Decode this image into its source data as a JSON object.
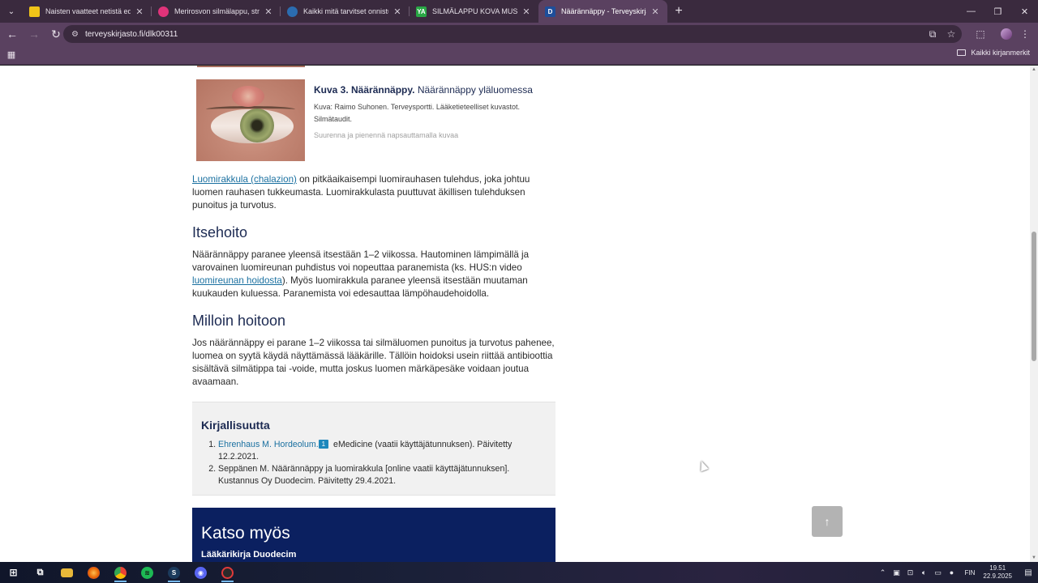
{
  "browser": {
    "tabs": [
      {
        "title": "Naisten vaatteet netistä edullise",
        "favicon_color": "#f0c419",
        "favicon_text": ""
      },
      {
        "title": "Merirosvon silmälappu, strassi j",
        "favicon_color": "#e0337a",
        "favicon_text": ""
      },
      {
        "title": "Kaikki mitä tarvitset onnistunee",
        "favicon_color": "#2b6cb0",
        "favicon_text": ""
      },
      {
        "title": "SILMÄLAPPU KOVA MUSTA KU",
        "favicon_color": "#29a745",
        "favicon_text": "YA"
      },
      {
        "title": "Näärännäppy - Terveyskirjasto",
        "favicon_color": "#1e4e9a",
        "favicon_text": "D"
      }
    ],
    "active_tab_index": 4,
    "url": "terveyskirjasto.fi/dlk00311",
    "bookmarks_all_label": "Kaikki kirjanmerkit"
  },
  "page": {
    "figure": {
      "title_bold": "Kuva 3. Näärännäppy.",
      "title_rest": " Näärännäppy yläluomessa",
      "credit": "Kuva: Raimo Suhonen. Terveysportti. Lääketieteelliset kuvastot. Silmätaudit.",
      "hint": "Suurenna ja pienennä napsauttamalla kuvaa"
    },
    "chalazion": {
      "link": "Luomirakkula (chalazion)",
      "text": " on pitkäaikaisempi luomirauhasen tulehdus, joka johtuu luomen rauhasen tukkeumasta. Luomirakkulasta puuttuvat äkillisen tulehduksen punoitus ja turvotus."
    },
    "itsehoito": {
      "heading": "Itsehoito",
      "text_before": "Näärännäppy paranee yleensä itsestään 1–2 viikossa. Hautominen lämpimällä ja varovainen luomireunan puhdistus voi nopeuttaa paranemista (ks. HUS:n video ",
      "link": "luomireunan hoidosta",
      "text_after": "). Myös luomirakkula paranee yleensä itsestään muutaman kuukauden kuluessa. Paranemista voi edesauttaa lämpöhaudehoidolla."
    },
    "milloin": {
      "heading": "Milloin hoitoon",
      "text": "Jos näärännäppy ei parane 1–2 viikossa tai silmäluomen punoitus ja turvotus pahenee, luomea on syytä käydä näyttämässä lääkärille. Tällöin hoidoksi usein riittää antibioottia sisältävä silmätippa tai -voide, mutta joskus luomen märkäpesäke voidaan joutua avaamaan."
    },
    "references": {
      "heading": "Kirjallisuutta",
      "items": [
        {
          "link": "Ehrenhaus M. Hordeolum.",
          "badge": "1",
          "text": " eMedicine (vaatii käyttäjätunnuksen). Päivitetty 12.2.2021."
        },
        {
          "link": "",
          "badge": "",
          "text": "Seppänen M. Näärännäppy ja luomirakkula [online vaatii käyttäjätunnuksen]. Kustannus Oy Duodecim. Päivitetty 29.4.2021."
        }
      ]
    },
    "see_also": {
      "heading": "Katso myös",
      "sub": "Lääkärikirja Duodecim"
    }
  },
  "taskbar": {
    "lang": "FIN",
    "time": "19.51",
    "date": "22.9.2025"
  }
}
